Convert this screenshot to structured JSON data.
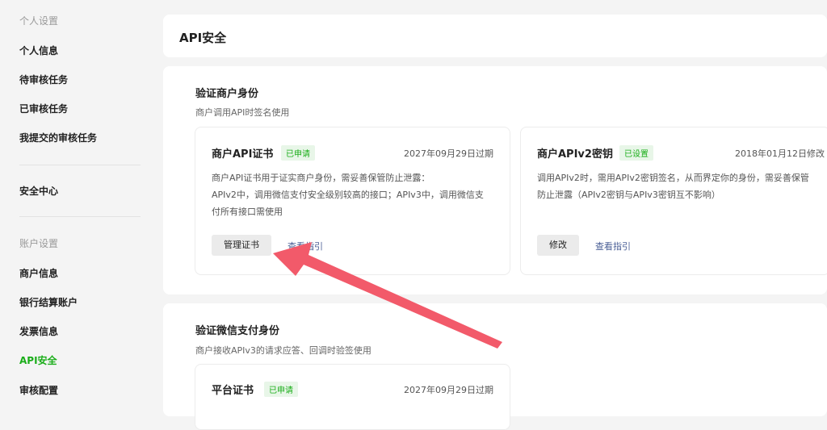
{
  "sidebar": {
    "section_personal": "个人设置",
    "personal_items": [
      "个人信息",
      "待审核任务",
      "已审核任务",
      "我提交的审核任务"
    ],
    "security_center": "安全中心",
    "section_account": "账户设置",
    "account_items": [
      "商户信息",
      "银行结算账户",
      "发票信息",
      "API安全",
      "审核配置"
    ],
    "active_item": "API安全",
    "accent_color": "#1aad19"
  },
  "header": {
    "title": "API安全"
  },
  "merchant_section": {
    "title": "验证商户身份",
    "subtitle": "商户调用API时签名使用",
    "cards": [
      {
        "title": "商户API证书",
        "status": "已申请",
        "date": "2027年09月29日过期",
        "desc_lines": [
          "商户API证书用于证实商户身份，需妥善保管防止泄露：",
          "APIv2中，调用微信支付安全级别较高的接口；APIv3中，调用微信支",
          "付所有接口需使用"
        ],
        "button": "管理证书",
        "link": "查看指引"
      },
      {
        "title": "商户APIv2密钥",
        "status": "已设置",
        "date": "2018年01月12日修改",
        "desc_lines": [
          "调用APIv2时，需用APIv2密钥签名，从而界定你的身份，需妥善保管",
          "防止泄露（APIv2密钥与APIv3密钥互不影响）"
        ],
        "button": "修改",
        "link": "查看指引"
      }
    ]
  },
  "wechat_section": {
    "title": "验证微信支付身份",
    "subtitle": "商户接收APIv3的请求应答、回调时验签使用",
    "cards": [
      {
        "title": "平台证书",
        "status": "已申请",
        "date": "2027年09月29日过期"
      }
    ]
  },
  "annotation": {
    "arrow_color": "#f25a6a"
  }
}
